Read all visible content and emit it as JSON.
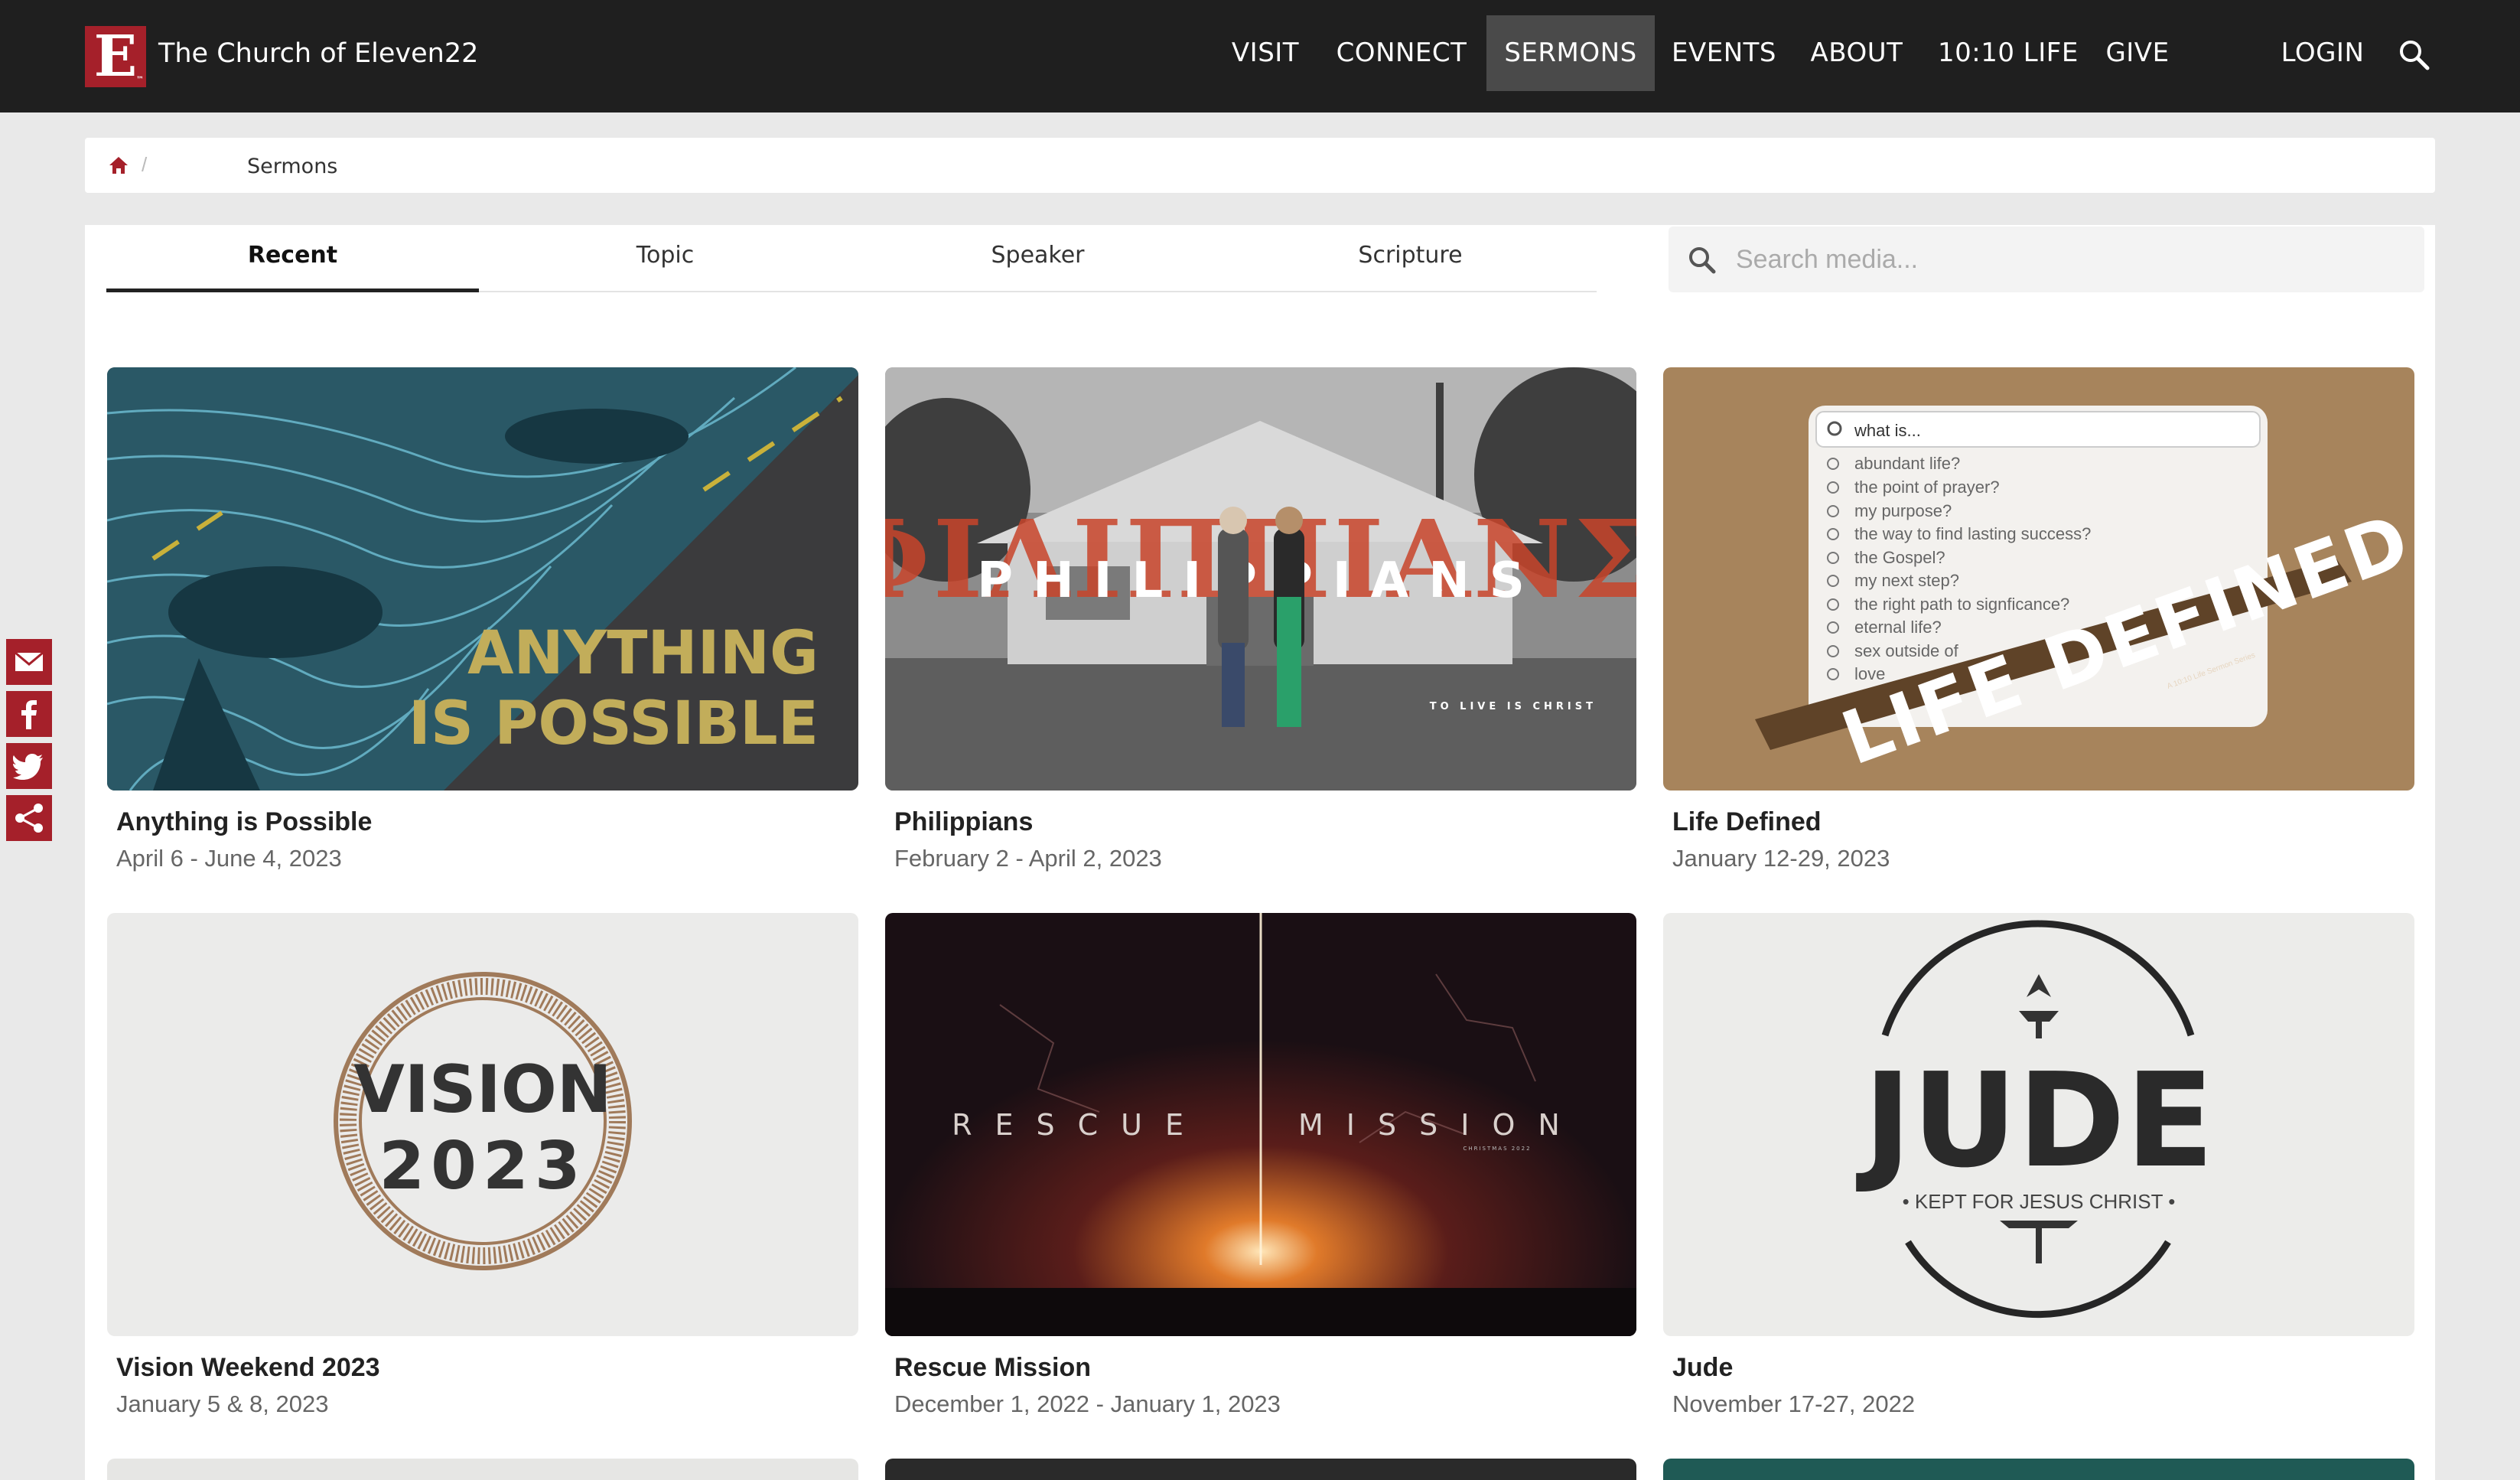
{
  "site": {
    "logo_letter": "E",
    "logo_tm": "™",
    "name": "The Church of Eleven22"
  },
  "nav": {
    "items": [
      "VISIT",
      "CONNECT",
      "SERMONS",
      "EVENTS",
      "ABOUT",
      "10:10 LIFE",
      "GIVE"
    ],
    "active": "SERMONS",
    "login": "LOGIN"
  },
  "breadcrumb": {
    "separator": "/",
    "current": "Sermons"
  },
  "tabs": [
    "Recent",
    "Topic",
    "Speaker",
    "Scripture"
  ],
  "search": {
    "placeholder": "Search media..."
  },
  "sermons": [
    {
      "title": "Anything is Possible",
      "date": "April 6 - June 4, 2023",
      "art_line1": "ANYTHING",
      "art_line2": "IS POSSIBLE"
    },
    {
      "title": "Philippians",
      "date": "February 2 - April 2, 2023",
      "art_text": "PHILIPPIANS",
      "art_sub": "TO LIVE IS CHRIST",
      "art_greek": "ΦΙΛΙΠΠΙΑΝΣ"
    },
    {
      "title": "Life Defined",
      "date": "January 12-29, 2023",
      "art_query": "what is...",
      "art_items": [
        "abundant life?",
        "the point of prayer?",
        "my purpose?",
        "the way to find lasting success?",
        "the Gospel?",
        "my next step?",
        "the right path to signficance?",
        "eternal life?",
        "sex outside of",
        "love"
      ],
      "art_banner": "LIFE DEFINED",
      "art_banner_sub": "A 10:10 Life Sermon Series"
    },
    {
      "title": "Vision Weekend 2023",
      "date": "January 5 & 8, 2023",
      "art_line1": "VISION",
      "art_line2": "2023"
    },
    {
      "title": "Rescue Mission",
      "date": "December 1, 2022 - January 1, 2023",
      "art_left": "RESCUE",
      "art_right": "MISSION",
      "art_sub": "CHRISTMAS 2022"
    },
    {
      "title": "Jude",
      "date": "November 17-27, 2022",
      "art_title": "JUDE",
      "art_sub": "• KEPT FOR JESUS CHRIST •"
    }
  ],
  "colors": {
    "brand_red": "#a5202a",
    "header_bg": "#1f1f1f",
    "active_nav_bg": "#4a4a4a",
    "page_bg": "#e9e9e9"
  },
  "social": [
    "email-icon",
    "facebook-icon",
    "twitter-icon",
    "share-icon"
  ]
}
